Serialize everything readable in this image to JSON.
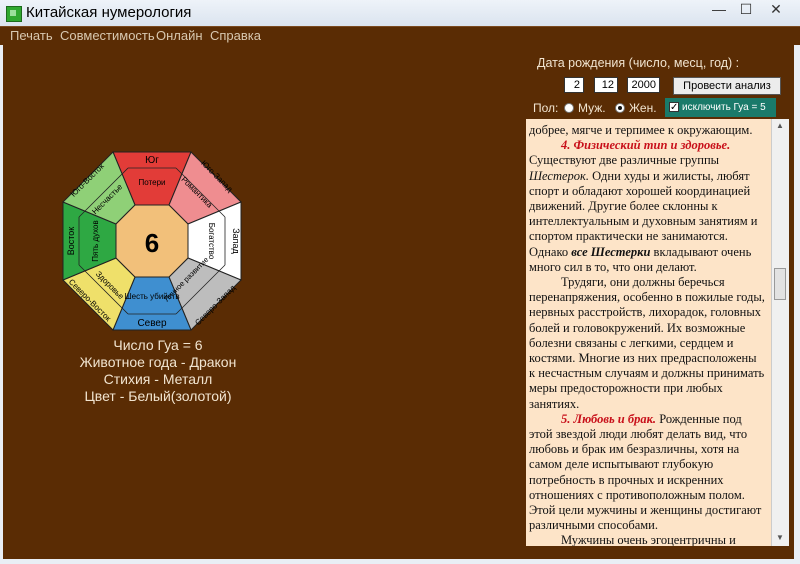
{
  "window": {
    "title": "Китайская нумерология",
    "minimize": "—",
    "maximize": "☐",
    "close": "✕"
  },
  "menu": [
    "Печать",
    "Совместимость",
    "Онлайн",
    "Справка"
  ],
  "birth": {
    "label": "Дата рождения (число, месц, год) :",
    "day": "2",
    "month": "12",
    "year": "2000",
    "analyze_button": "Провести анализ"
  },
  "gender": {
    "label": "Пол:",
    "male": "Муж.",
    "female": "Жен.",
    "selected": "female",
    "exclude_label": "исключить Гуа = 5",
    "exclude_checked": true
  },
  "bagua": {
    "center_number": "6",
    "sectors": [
      {
        "name": "Юг",
        "meaning": "Потери",
        "color": "#e23c38"
      },
      {
        "name": "Юго-Запад",
        "meaning": "Романтика",
        "color": "#ef8d90"
      },
      {
        "name": "Запад",
        "meaning": "Богатство",
        "color": "#ffffff"
      },
      {
        "name": "Северо-Запад",
        "meaning": "Личное развитие",
        "color": "#bdbdbd"
      },
      {
        "name": "Север",
        "meaning": "Шесть убийств",
        "color": "#3f8fd0"
      },
      {
        "name": "Северо-Восток",
        "meaning": "Здоровье",
        "color": "#efe06a"
      },
      {
        "name": "Восток",
        "meaning": "Пять духов",
        "color": "#2ea843"
      },
      {
        "name": "Юго-Восток",
        "meaning": "Несчастье",
        "color": "#8fd077"
      }
    ],
    "center_color": "#f2c07a"
  },
  "info": {
    "gua_label": "Число Гуа = ",
    "gua_value": "6",
    "animal_label": "Животное года - ",
    "animal_value": "Дракон",
    "element_label": "Стихия - ",
    "element_value": "Металл",
    "color_label": "Цвет - ",
    "color_value": "Белый(золотой)"
  },
  "text": {
    "p0": "добрее, мягче и терпимее к окружающим.",
    "h4": "4. Физический тип и здоровье.",
    "p1a": "Существуют две различные группы ",
    "p1b": "Шестерок.",
    "p1c": " Одни худы и жилисты, любят спорт и обладают хорошей координацией движений. Другие более склонны к интеллектуальным и духовным занятиям и спортом практически не занимаются. Однако ",
    "p1d": "все Шестерки",
    "p1e": " вкладывают очень много сил в то, что они делают.",
    "p2": "Трудяги, они должны беречься перенапряжения, особенно в пожилые годы, нервных расстройств, лихорадок, головных болей и головокружений. Их возможные болезни связаны с легкими, сердцем и костями. Многие из них предрасположены к несчастным случаям и должны принимать меры предосторожности при любых занятиях.",
    "h5": "5. Любовь  и  брак.",
    "p3": " Рожденные под этой звездой люди любят делать вид, что любовь и брак им безразличны, хотя на самом деле испытывают глубокую потребность в прочных и искренних отношениях с противоположным полом. Этой цели мужчины и женщины достигают различными способами.",
    "p4": "Мужчины очень эгоцентричны и"
  }
}
